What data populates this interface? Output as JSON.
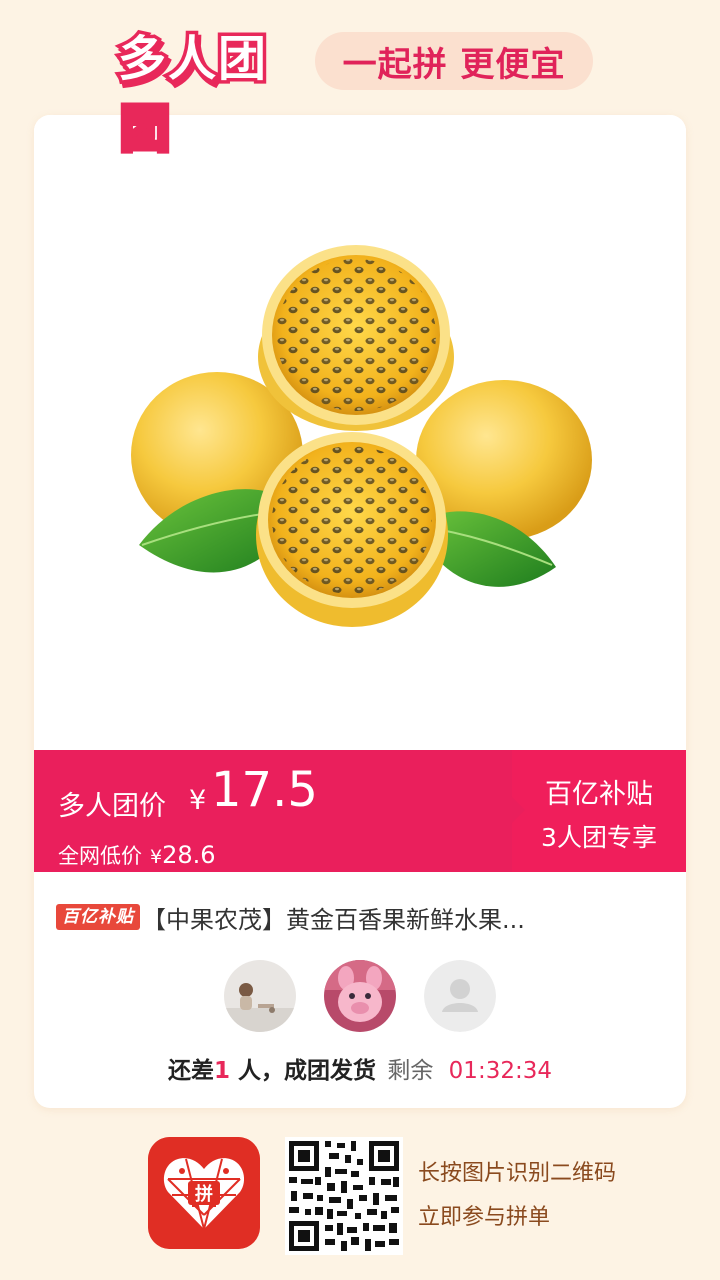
{
  "header": {
    "brand": "多人团",
    "slogan": "一起拼 更便宜"
  },
  "price_bar": {
    "label": "多人团价",
    "currency": "¥",
    "price": "17.5",
    "original_label": "全网低价",
    "original_currency": "¥",
    "original_price": "28.6",
    "subsidy_title": "百亿补贴",
    "subsidy_sub": "3人团专享"
  },
  "product": {
    "badge": "百亿补贴",
    "title": "【中果农茂】黄金百香果新鲜水果..."
  },
  "group_status": {
    "prefix": "还差",
    "count": "1",
    "suffix": " 人，成团发货",
    "remaining_label": "剩余",
    "timer": "01:32:34"
  },
  "footer": {
    "line1": "长按图片识别二维码",
    "line2": "立即参与拼单"
  },
  "colors": {
    "accent": "#ea1f5c",
    "background": "#fdf3e4",
    "footer_text": "#8a4a1e"
  },
  "icons": [
    "default-avatar-icon",
    "pinduoduo-app-icon",
    "qr-code"
  ]
}
